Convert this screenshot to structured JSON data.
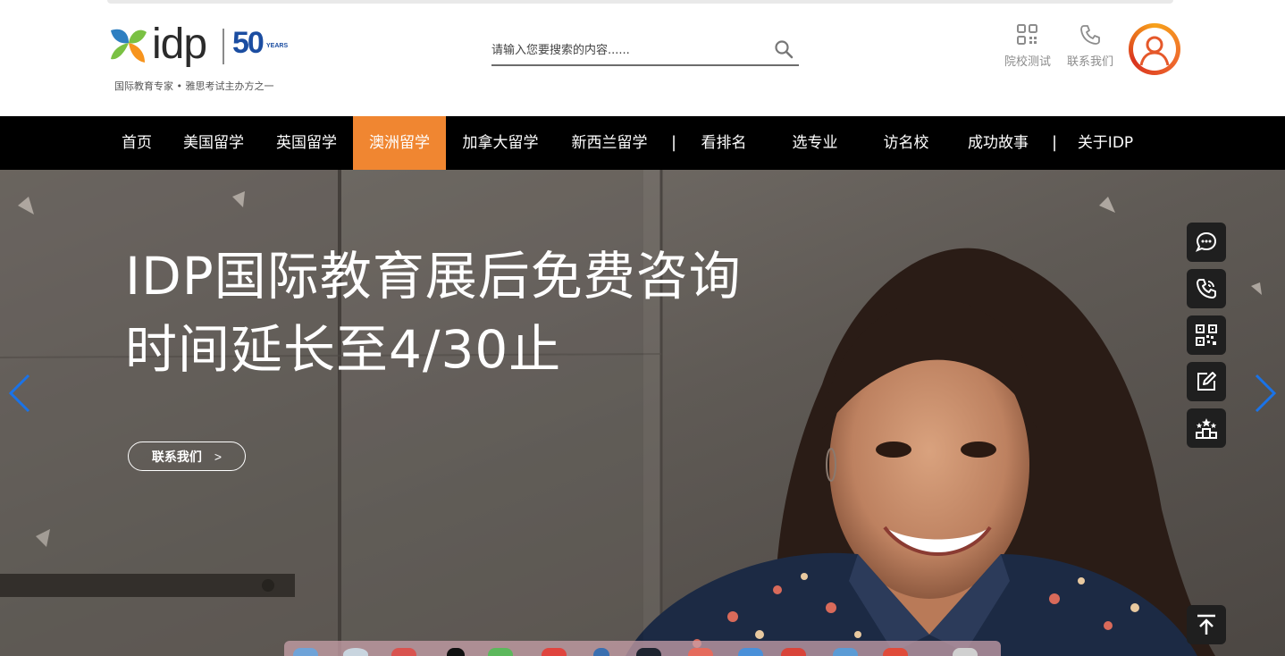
{
  "brand": {
    "wordmark": "idp",
    "anniversary_number": "50",
    "anniversary_label": "YEARS",
    "tagline": "国际教育专家 • 雅思考试主办方之一",
    "logo_colors": [
      "#f7941d",
      "#7ac143",
      "#2e7fc1"
    ]
  },
  "search": {
    "placeholder": "请输入您要搜索的内容......",
    "icon": "search-icon"
  },
  "header_tools": [
    {
      "label": "院校测试",
      "icon": "qr-grid-icon"
    },
    {
      "label": "联系我们",
      "icon": "phone-icon"
    }
  ],
  "user": {
    "icon": "user-avatar-icon"
  },
  "nav": {
    "items": [
      {
        "label": "首页",
        "active": false
      },
      {
        "label": "美国留学",
        "active": false
      },
      {
        "label": "英国留学",
        "active": false
      },
      {
        "label": "澳洲留学",
        "active": true
      },
      {
        "label": "加拿大留学",
        "active": false
      },
      {
        "label": "新西兰留学",
        "active": false
      },
      {
        "label": "看排名",
        "active": false
      },
      {
        "label": "选专业",
        "active": false
      },
      {
        "label": "访名校",
        "active": false
      },
      {
        "label": "成功故事",
        "active": false
      },
      {
        "label": "关于IDP",
        "active": false
      }
    ],
    "divider": "|",
    "active_color": "#f08631"
  },
  "hero": {
    "title_line1": "IDP国际教育展后免费咨询",
    "title_line2": "时间延长至4/30止",
    "cta_label": "联系我们",
    "cta_chevron": ">",
    "arrow_color": "#1a73e8"
  },
  "side_toolbar": [
    {
      "icon": "chat-bubble-icon"
    },
    {
      "icon": "phone-call-icon"
    },
    {
      "icon": "qr-code-icon"
    },
    {
      "icon": "edit-form-icon"
    },
    {
      "icon": "ranking-stars-icon"
    },
    {
      "icon": "back-to-top-icon"
    }
  ]
}
